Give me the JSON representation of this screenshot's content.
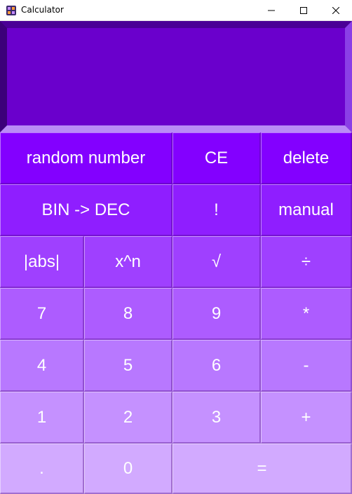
{
  "window": {
    "title": "Calculator",
    "icon": "purple-calculator-icon"
  },
  "display": {
    "value": ""
  },
  "keys": {
    "random_number": "random number",
    "ce": "CE",
    "delete": "delete",
    "bin_dec": "BIN -> DEC",
    "factorial": "!",
    "manual": "manual",
    "abs": "|abs|",
    "power": "x^n",
    "sqrt": "√",
    "divide": "÷",
    "seven": "7",
    "eight": "8",
    "nine": "9",
    "multiply": "*",
    "four": "4",
    "five": "5",
    "six": "6",
    "minus": "-",
    "one": "1",
    "two": "2",
    "three": "3",
    "plus": "+",
    "dot": ".",
    "zero": "0",
    "equals": "="
  },
  "colors": {
    "display_bg": "#6a00cc",
    "row1": "#8300ff",
    "row7": "#d2aaff"
  }
}
